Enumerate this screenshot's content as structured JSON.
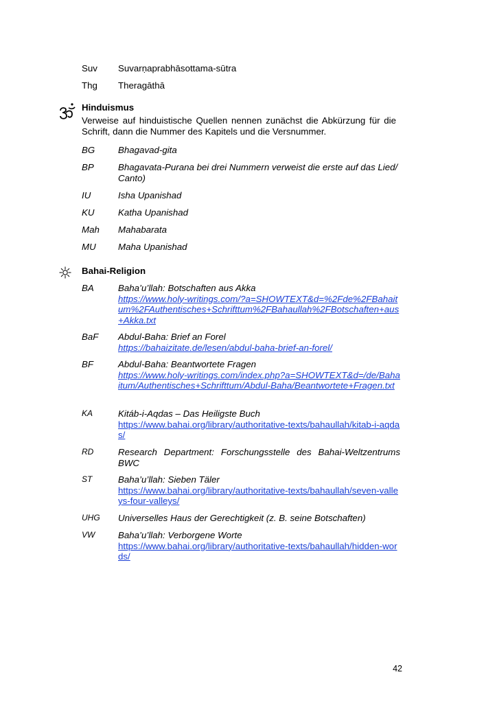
{
  "buddhism_tail": [
    {
      "abbr": "Suv",
      "text": "Suvarṇaprabhāsottama-sūtra"
    },
    {
      "abbr": "Thg",
      "text": "Theragāthā"
    }
  ],
  "hinduism": {
    "icon": "om-icon",
    "heading": "Hinduismus",
    "intro": "Verweise auf hinduistische Quellen nennen zunächst die Abkürzung für die Schrift, dann die Nummer des Kapitels und die Versnummer.",
    "entries": [
      {
        "abbr": "BG",
        "text": "Bhagavad-gita"
      },
      {
        "abbr": "BP",
        "text": "Bhagavata-Purana bei drei Nummern verweist die erste auf das Lied/ Canto)"
      },
      {
        "abbr": "IU",
        "text": "Isha Upanishad"
      },
      {
        "abbr": "KU",
        "text": "Katha Upanishad"
      },
      {
        "abbr": "Mah",
        "text": "Mahabarata"
      },
      {
        "abbr": "MU",
        "text": "Maha Upanishad"
      }
    ]
  },
  "bahai": {
    "icon": "nine-pointed-star-icon",
    "heading": "Bahai-Religion",
    "entries": [
      {
        "abbr": "BA",
        "text": "Baha’u’llah: Botschaften aus Akka",
        "link": "https://www.holy-writings.com/?a=SHOWTEXT&d=%2Fde%2FBahaitum%2FAuthentisches+Schrifttum%2FBahaullah%2FBotschaften+aus+Akka.txt"
      },
      {
        "abbr": "BaF",
        "text": "Abdul-Baha: Brief an Forel",
        "link": "https://bahaizitate.de/lesen/abdul-baha-brief-an-forel/"
      },
      {
        "abbr": "BF",
        "text": "Abdul-Baha: Beantwortete Fragen",
        "link": "https://www.holy-writings.com/index.php?a=SHOWTEXT&d=/de/Bahaitum/Authentisches+Schrifttum/Abdul-Baha/Beantwortete+Fragen.txt"
      },
      {
        "abbr": "KA",
        "text": "Kitáb-i-Aqdas – Das Heiligste Buch",
        "link": "https://www.bahai.org/library/authoritative-texts/bahaullah/kitab-i-aqdas/"
      },
      {
        "abbr": "RD",
        "text": "Research Department: Forschungsstelle des Bahai-Weltzentrums BWC"
      },
      {
        "abbr": "ST",
        "text": "Baha’u’llah: Sieben Täler",
        "link": "https://www.bahai.org/library/authoritative-texts/bahaullah/seven-valleys-four-valleys/"
      },
      {
        "abbr": "UHG",
        "text": "Universelles Haus der Gerechtigkeit (z. B. seine Botschaften)"
      },
      {
        "abbr": "VW",
        "text": "Baha’u’llah: Verborgene Worte",
        "link": "https://www.bahai.org/library/authoritative-texts/bahaullah/hidden-words/"
      }
    ]
  },
  "page_number": "42"
}
